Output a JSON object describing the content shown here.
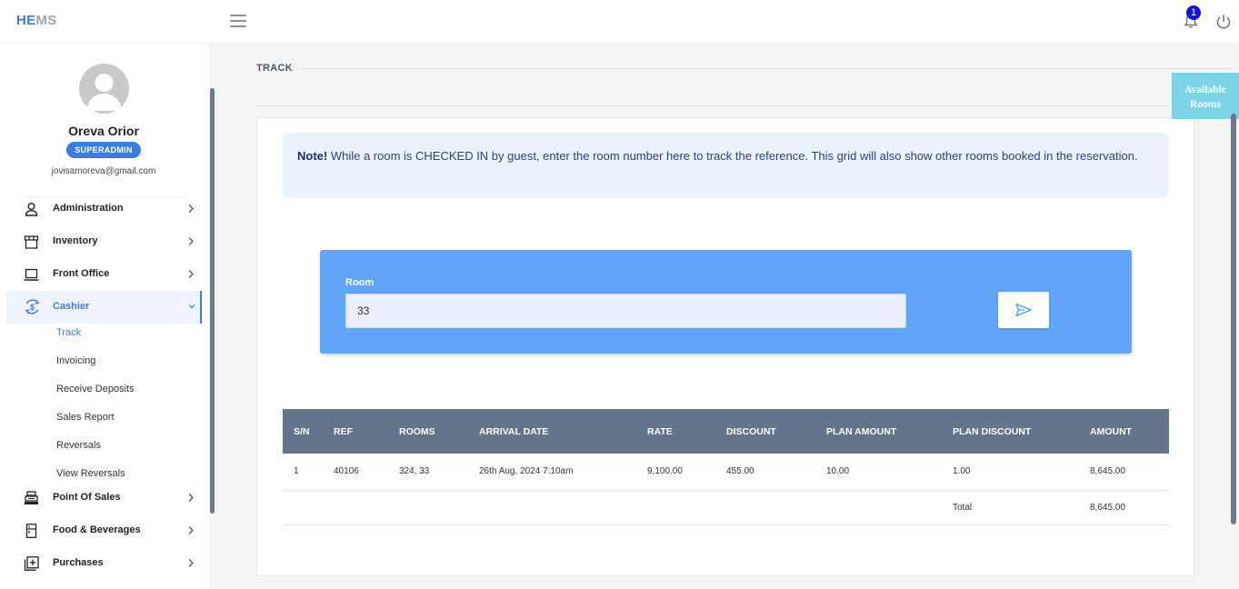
{
  "app": {
    "logo_a": "HE",
    "logo_b": "MS"
  },
  "notifications": {
    "count": "1"
  },
  "user": {
    "name": "Oreva Orior",
    "role": "SUPERADMIN",
    "email": "jovisamoreva@gmail.com"
  },
  "sidebar": {
    "items": [
      {
        "label": "Administration"
      },
      {
        "label": "Inventory"
      },
      {
        "label": "Front Office"
      },
      {
        "label": "Cashier"
      },
      {
        "label": "Point Of Sales"
      },
      {
        "label": "Food & Beverages"
      },
      {
        "label": "Purchases"
      }
    ],
    "cashier_sub": [
      {
        "label": "Track"
      },
      {
        "label": "Invoicing"
      },
      {
        "label": "Receive Deposits"
      },
      {
        "label": "Sales Report"
      },
      {
        "label": "Reversals"
      },
      {
        "label": "View Reversals"
      }
    ]
  },
  "page": {
    "title": "TRACK"
  },
  "note": {
    "prefix": "Note!",
    "text": " While a room is CHECKED IN by guest, enter the room number here to track the reference. This grid will also show other rooms booked in the reservation."
  },
  "form": {
    "room_label": "Room",
    "room_value": "33"
  },
  "table": {
    "headers": [
      "S/N",
      "REF",
      "ROOMS",
      "ARRIVAL DATE",
      "RATE",
      "DISCOUNT",
      "PLAN AMOUNT",
      "PLAN DISCOUNT",
      "AMOUNT"
    ],
    "rows": [
      [
        "1",
        "40106",
        "324, 33",
        "26th Aug, 2024 7:10am",
        "9,100.00",
        "455.00",
        "10.00",
        "1.00",
        "8,645.00"
      ]
    ],
    "total_label": "Total",
    "total_value": "8,645.00"
  },
  "available_rooms": {
    "line1": "Available",
    "line2": "Rooms"
  }
}
